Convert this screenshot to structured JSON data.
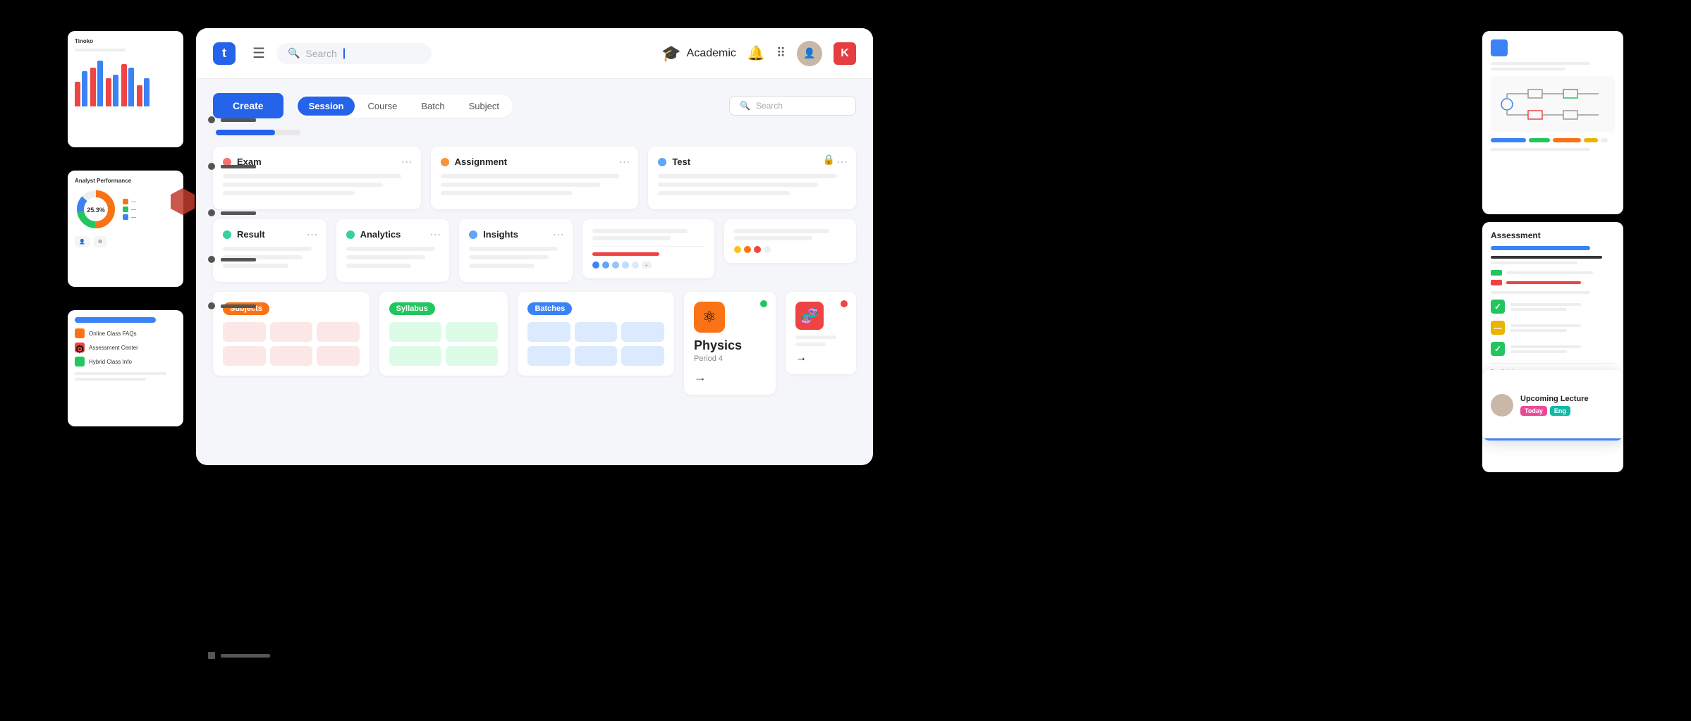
{
  "header": {
    "logo": "t",
    "search_placeholder": "Search",
    "search_cursor": "|",
    "academic_label": "Academic",
    "k_badge": "K"
  },
  "tabs": {
    "items": [
      "Session",
      "Course",
      "Batch",
      "Subject"
    ],
    "active": "Session"
  },
  "create_button": "Create",
  "toolbar_search_placeholder": "Search",
  "cards": [
    {
      "title": "Exam",
      "dot_color": "#f87171"
    },
    {
      "title": "Assignment",
      "dot_color": "#fb923c"
    },
    {
      "title": "Test",
      "dot_color": "#60a5fa"
    },
    {
      "title": "Result",
      "dot_color": "#34d399"
    },
    {
      "title": "Analytics",
      "dot_color": "#34d399"
    },
    {
      "title": "Insights",
      "dot_color": "#60a5fa"
    }
  ],
  "subject_tags": [
    {
      "label": "Subjects",
      "color": "tag-orange"
    },
    {
      "label": "Syllabus",
      "color": "tag-green"
    },
    {
      "label": "Batches",
      "color": "tag-blue"
    }
  ],
  "physics": {
    "title": "Physics",
    "period": "Period 4",
    "icon": "⚛"
  },
  "upcoming_lecture": {
    "title": "Upcoming Lecture",
    "tags": [
      "Today",
      "Eng"
    ]
  },
  "assessment": {
    "title": "Assessment"
  },
  "sidebar": {
    "dot_count": 5
  }
}
